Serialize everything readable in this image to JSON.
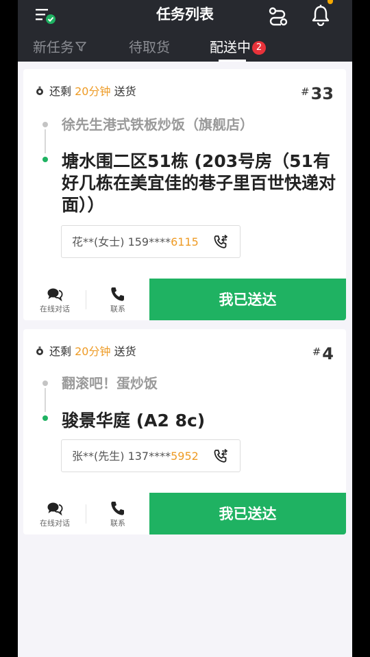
{
  "header": {
    "title": "任务列表",
    "icons": [
      "menu-check-icon",
      "route-icon",
      "bell-icon"
    ]
  },
  "tabs": [
    {
      "label": "新任务",
      "selected": false
    },
    {
      "label": "待取货",
      "selected": false
    },
    {
      "label": "配送中",
      "selected": true,
      "badge": "2"
    }
  ],
  "orders": [
    {
      "time_prefix": "还剩",
      "time_value": "20分钟",
      "time_suffix": "送货",
      "hash": "#",
      "number": "33",
      "shop": "徐先生港式铁板炒饭（旗舰店）",
      "address": "塘水围二区51栋 (203号房（51有好几栋在美宜佳的巷子里百世快递对面））",
      "contact_prefix": "花**(女士) 159****",
      "contact_tail": "6115",
      "chat_label": "在线对话",
      "call_label": "联系",
      "done_label": "我已送达"
    },
    {
      "time_prefix": "还剩",
      "time_value": "20分钟",
      "time_suffix": "送货",
      "hash": "#",
      "number": "4",
      "shop": "翻滚吧！蛋炒饭",
      "address": "骏景华庭 (A2 8c)",
      "contact_prefix": "张**(先生) 137****",
      "contact_tail": "5952",
      "chat_label": "在线对话",
      "call_label": "联系",
      "done_label": "我已送达"
    }
  ],
  "colors": {
    "header_bg": "#27292f",
    "accent_green": "#1fb262",
    "time_orange": "#ee9b25",
    "badge_red": "#e8323a"
  }
}
